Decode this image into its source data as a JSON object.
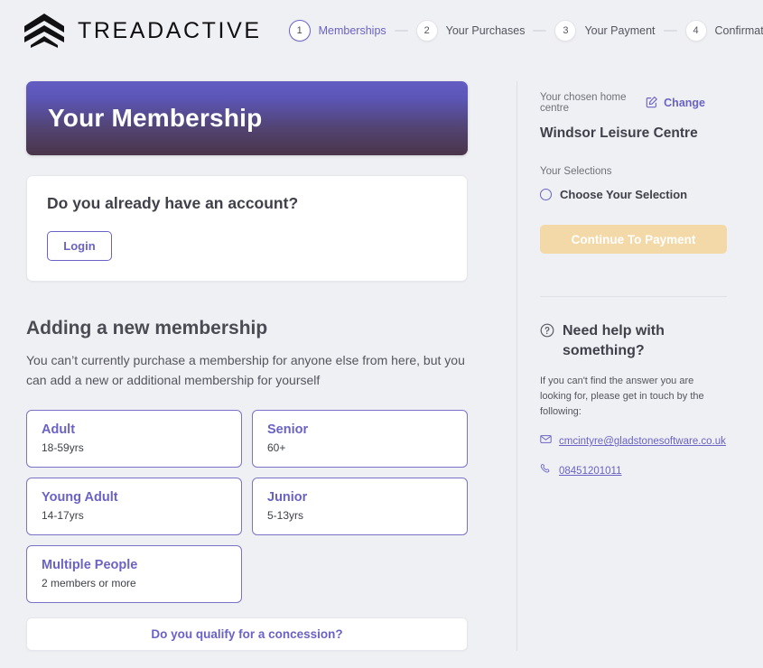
{
  "brand": {
    "name": "TREADACTIVE",
    "logo_icon": "stacked-chevron-logo"
  },
  "stepper": {
    "steps": [
      {
        "number": "1",
        "label": "Memberships",
        "active": true
      },
      {
        "number": "2",
        "label": "Your Purchases",
        "active": false
      },
      {
        "number": "3",
        "label": "Your Payment",
        "active": false
      },
      {
        "number": "4",
        "label": "Confirmation",
        "active": false
      }
    ]
  },
  "hero": {
    "title": "Your Membership",
    "gradient_from": "#635dc3",
    "gradient_to": "#4b3549"
  },
  "account": {
    "question": "Do you already have an account?",
    "login_label": "Login"
  },
  "adding": {
    "title": "Adding a new membership",
    "subtitle": "You can’t currently purchase a membership for anyone else from here, but you can add a new or additional membership for yourself",
    "options": [
      {
        "title": "Adult",
        "sub": "18-59yrs"
      },
      {
        "title": "Senior",
        "sub": "60+"
      },
      {
        "title": "Young Adult",
        "sub": "14-17yrs"
      },
      {
        "title": "Junior",
        "sub": "5-13yrs"
      },
      {
        "title": "Multiple People",
        "sub": "2 members or more"
      }
    ],
    "concession_label": "Do you qualify for a concession?"
  },
  "sidebar": {
    "home_centre_caption": "Your chosen home centre",
    "change_label": "Change",
    "change_icon": "pencil-square-icon",
    "centre_name": "Windsor Leisure Centre",
    "selections_caption": "Your Selections",
    "selection_placeholder": "Choose Your Selection",
    "selection_radio_icon": "radio-unchecked-icon",
    "cta_label": "Continue To Payment",
    "cta_color": "#f4d9a8",
    "help": {
      "icon": "question-circle-icon",
      "title": "Need help with something?",
      "subtitle": "If you can't find the answer you are looking for, please get in touch by the following:",
      "email": "cmcintyre@gladstonesoftware.co.uk",
      "email_icon": "envelope-icon",
      "phone": "08451201011",
      "phone_icon": "phone-icon"
    }
  },
  "theme": {
    "accent": "#6a62c4",
    "page_bg": "#eff0f3"
  }
}
